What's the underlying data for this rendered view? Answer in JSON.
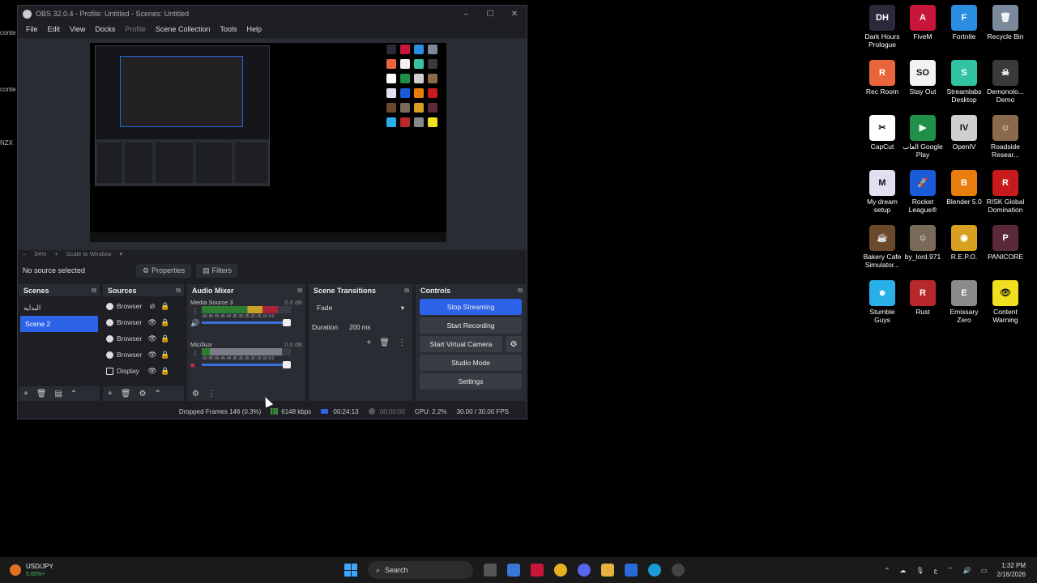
{
  "obs": {
    "title": "OBS 32.0.4 - Profile: Untitled - Scenes: Untitled",
    "menu": [
      "File",
      "Edit",
      "View",
      "Docks",
      "Profile",
      "Scene Collection",
      "Tools",
      "Help"
    ],
    "zoom": "34%",
    "scale_mode": "Scale to Window",
    "no_source": "No source selected",
    "properties_label": "Properties",
    "filters_label": "Filters",
    "docks": {
      "scenes": "Scenes",
      "sources": "Sources",
      "audio_mixer": "Audio Mixer",
      "scene_transitions": "Scene Transitions",
      "controls": "Controls"
    },
    "scenes": [
      "البدايه",
      "Scene 2"
    ],
    "sources": [
      {
        "name": "Browser",
        "icon": "globe-icon",
        "visible": false
      },
      {
        "name": "Browser",
        "icon": "globe-icon",
        "visible": true
      },
      {
        "name": "Browser",
        "icon": "globe-icon",
        "visible": true
      },
      {
        "name": "Browser",
        "icon": "globe-icon",
        "visible": true
      },
      {
        "name": "Display",
        "icon": "monitor-icon",
        "visible": true
      }
    ],
    "mixer": [
      {
        "name": "Media Source 3",
        "db": "0.0 dB",
        "level": 0.85
      },
      {
        "name": "Mic/Aux",
        "db": "0.0 dB",
        "level": 0.9
      }
    ],
    "meter_scale": "-60 -55 -50 -45 -40 -35 -30 -25 -20 -15 -10 -5 0",
    "transition": "Fade",
    "duration_label": "Duration",
    "duration_value": "200 ms",
    "controls": {
      "stop_streaming": "Stop Streaming",
      "start_recording": "Start Recording",
      "start_virtual_camera": "Start Virtual Camera",
      "studio_mode": "Studio Mode",
      "settings": "Settings"
    },
    "status": {
      "dropped_frames": "Dropped Frames 146 (0.3%)",
      "bitrate": "6148 kbps",
      "stream_time": "00:24:13",
      "rec_time": "00:00:00",
      "cpu": "CPU: 2.2%",
      "fps": "30.00 / 30.00 FPS"
    }
  },
  "desktop_icons": [
    {
      "label": "Dark Hours Prologue",
      "color": "#2a2a3a",
      "glyph": "DH"
    },
    {
      "label": "FiveM",
      "color": "#c8163a",
      "glyph": "A"
    },
    {
      "label": "Fortnite",
      "color": "#2a8fe0",
      "glyph": "F"
    },
    {
      "label": "Recycle Bin",
      "color": "#7a8a9a",
      "glyph": "🗑"
    },
    {
      "label": "Rec Room",
      "color": "#e8663a",
      "glyph": "R"
    },
    {
      "label": "Stay Out",
      "color": "#f2f2f2",
      "glyph": "SO"
    },
    {
      "label": "Streamlabs Desktop",
      "color": "#31c3a2",
      "glyph": "S"
    },
    {
      "label": "Demonolo... Demo",
      "color": "#3a3a3a",
      "glyph": "☠"
    },
    {
      "label": "CapCut",
      "color": "#ffffff",
      "glyph": "✂"
    },
    {
      "label": "العاب Google Play",
      "color": "#1f8f4a",
      "glyph": "▶"
    },
    {
      "label": "OpenIV",
      "color": "#cfcfcf",
      "glyph": "IV"
    },
    {
      "label": "Roadside Resear...",
      "color": "#8a6a4a",
      "glyph": "☺"
    },
    {
      "label": "My dream setup",
      "color": "#e0e0f0",
      "glyph": "M"
    },
    {
      "label": "Rocket League®",
      "color": "#1a5bd8",
      "glyph": "🚀"
    },
    {
      "label": "Blender 5.0",
      "color": "#e87d0d",
      "glyph": "B"
    },
    {
      "label": "RISK Global Domination",
      "color": "#c81a1a",
      "glyph": "R"
    },
    {
      "label": "Bakery Cafe Simulator...",
      "color": "#6a4a2a",
      "glyph": "☕"
    },
    {
      "label": "by_lord.971",
      "color": "#7a6a5a",
      "glyph": "☺"
    },
    {
      "label": "R.E.P.O.",
      "color": "#d8a020",
      "glyph": "◉"
    },
    {
      "label": "PANICORE",
      "color": "#5a2a3a",
      "glyph": "P"
    },
    {
      "label": "Stumble Guys",
      "color": "#2ab0e8",
      "glyph": "☻"
    },
    {
      "label": "Rust",
      "color": "#b8282a",
      "glyph": "R"
    },
    {
      "label": "Emissary Zero",
      "color": "#8a8a8a",
      "glyph": "E"
    },
    {
      "label": "Content Warning",
      "color": "#f0e020",
      "glyph": "👁"
    }
  ],
  "left_peek": [
    "conte",
    "conte",
    "NZX"
  ],
  "taskbar": {
    "ticker_name": "USD/JPY",
    "ticker_value": "0.60%+",
    "search": "Search",
    "time": "1:32 PM",
    "date": "2/16/2026"
  }
}
